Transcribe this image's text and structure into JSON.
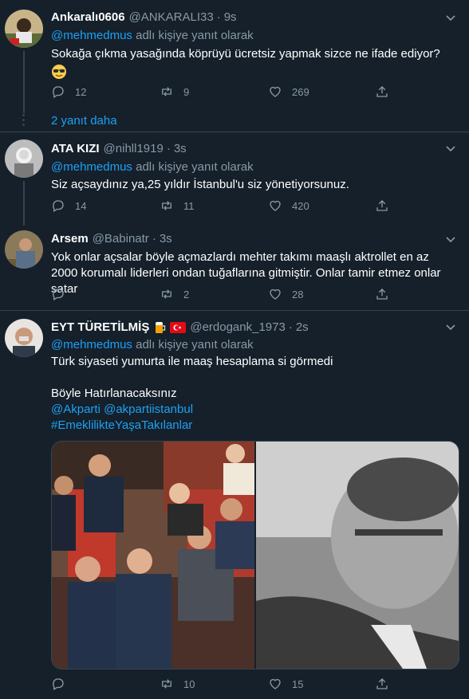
{
  "colors": {
    "background": "#15202b",
    "accent": "#1da1f2",
    "muted": "#8899a6",
    "divider": "#38444d"
  },
  "tweets": [
    {
      "name": "Ankaralı0606",
      "handle": "@ANKARALI33",
      "dot": "·",
      "time": "9s",
      "reply_prefix": "",
      "reply_mention": "@mehmedmus",
      "reply_suffix": " adlı kişiye yanıt olarak",
      "text": "Sokağa çıkma yasağında köprüyü ücretsiz yapmak sizce ne ifade ediyor?",
      "emoji_icon": "sunglasses-emoji-icon",
      "replies": "12",
      "retweets": "9",
      "likes": "269"
    },
    {
      "name": "ATA KIZI",
      "handle": "@nihll1919",
      "dot": "·",
      "time": "3s",
      "reply_mention": "@mehmedmus",
      "reply_suffix": " adlı kişiye yanıt olarak",
      "text": "Siz açsaydınız ya,25 yıldır İstanbul'u siz yönetiyorsunuz.",
      "replies": "14",
      "retweets": "11",
      "likes": "420"
    },
    {
      "name": "Arsem",
      "handle": "@Babinatr",
      "dot": "·",
      "time": "3s",
      "text": "Yok onlar açsalar böyle açmazlardı mehter takımı maaşlı aktrollet en az 2000 korumalı liderleri ondan tuğaflarına gitmiştir. Onlar tamir etmez onlar satar",
      "replies": "",
      "retweets": "2",
      "likes": "28"
    },
    {
      "name": "EYT TÜRETİLMİŞ",
      "name_icons": [
        "beer-emoji-icon",
        "turkey-flag-icon"
      ],
      "handle": "@erdogank_1973",
      "dot": "·",
      "time": "2s",
      "reply_mention": "@mehmedmus",
      "reply_suffix": " adlı kişiye yanıt olarak",
      "text_line1": "Türk siyaseti yumurta ile maaş hesaplama si görmedi",
      "text_line2": "Böyle Hatırlanacaksınız",
      "link1": "@Akparti",
      "link2": "@akpartiistanbul",
      "hashtag": "#EmeklilikteYaşaTakılanlar",
      "replies": "",
      "retweets": "10",
      "likes": "15"
    }
  ],
  "show_more": "2 yanıt daha"
}
